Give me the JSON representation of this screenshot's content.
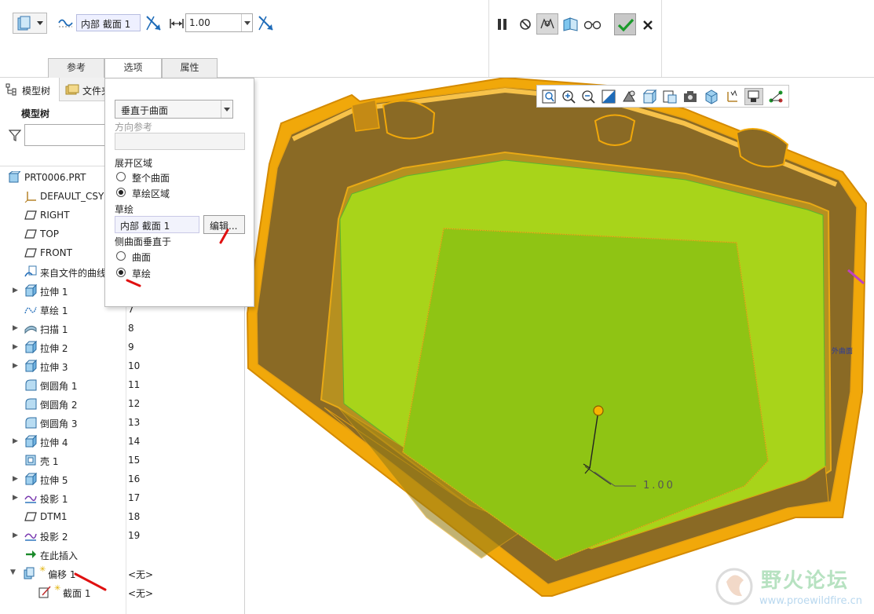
{
  "dashboard": {
    "section_value": "内部 截面 1",
    "offset_value": "1.00"
  },
  "tabs": [
    {
      "label": "参考"
    },
    {
      "label": "选项"
    },
    {
      "label": "属性"
    }
  ],
  "tree": {
    "tab_model": "模型树",
    "tab_file": "文件夹",
    "header": "模型树",
    "items": [
      {
        "label": "PRT0006.PRT",
        "col2": "",
        "icon": "part-icon"
      },
      {
        "label": "DEFAULT_CSYS",
        "col2": "",
        "icon": "csys-icon"
      },
      {
        "label": "RIGHT",
        "col2": "",
        "icon": "datum-plane-icon"
      },
      {
        "label": "TOP",
        "col2": "",
        "icon": "datum-plane-icon"
      },
      {
        "label": "FRONT",
        "col2": "",
        "icon": "datum-plane-icon"
      },
      {
        "label": "来自文件的曲线",
        "col2": "",
        "icon": "curve-from-file-icon"
      },
      {
        "label": "拉伸 1",
        "col2": "",
        "icon": "extrude-icon"
      },
      {
        "label": "草绘 1",
        "col2": "7",
        "icon": "sketch-icon"
      },
      {
        "label": "扫描 1",
        "col2": "8",
        "icon": "sweep-icon"
      },
      {
        "label": "拉伸 2",
        "col2": "9",
        "icon": "extrude-icon"
      },
      {
        "label": "拉伸 3",
        "col2": "10",
        "icon": "extrude-icon"
      },
      {
        "label": "倒圆角 1",
        "col2": "11",
        "icon": "round-icon"
      },
      {
        "label": "倒圆角 2",
        "col2": "12",
        "icon": "round-icon"
      },
      {
        "label": "倒圆角 3",
        "col2": "13",
        "icon": "round-icon"
      },
      {
        "label": "拉伸 4",
        "col2": "14",
        "icon": "extrude-icon"
      },
      {
        "label": "壳 1",
        "col2": "15",
        "icon": "shell-icon"
      },
      {
        "label": "拉伸 5",
        "col2": "16",
        "icon": "extrude-icon"
      },
      {
        "label": "投影 1",
        "col2": "17",
        "icon": "project-icon"
      },
      {
        "label": "DTM1",
        "col2": "18",
        "icon": "datum-plane-icon"
      },
      {
        "label": "投影 2",
        "col2": "19",
        "icon": "project-icon"
      },
      {
        "label": "在此插入",
        "col2": "",
        "icon": "insert-here-icon"
      },
      {
        "label": "偏移 1",
        "col2": "<无>",
        "icon": "offset-icon"
      },
      {
        "label": "截面 1",
        "col2": "<无>",
        "icon": "section-sketch-icon"
      }
    ]
  },
  "options": {
    "direction_select": "垂直于曲面",
    "direction_ref_label": "方向参考",
    "expand_area_label": "展开区域",
    "radio_whole_surface": "整个曲面",
    "radio_sketch_area": "草绘区域",
    "sketch_label": "草绘",
    "sketch_value": "内部 截面 1",
    "edit_button": "编辑...",
    "side_normal_label": "侧曲面垂直于",
    "radio_surface": "曲面",
    "radio_sketch": "草绘"
  },
  "viewport": {
    "dimension_value": "1.00",
    "side_label": "外曲面"
  },
  "watermark": {
    "title": "野火论坛",
    "url": "www.proewildfire.cn"
  },
  "colors": {
    "accent_green": "#5bb62e",
    "model_orange": "#f0a000",
    "model_brown": "#8a6a25",
    "surface_green": "#a8d41a",
    "annotation_red": "#e01010"
  }
}
